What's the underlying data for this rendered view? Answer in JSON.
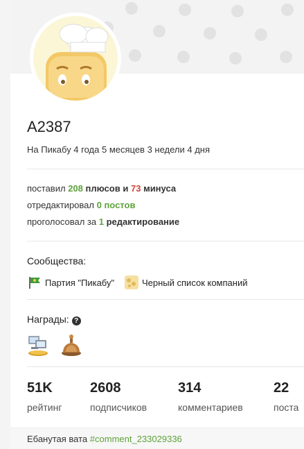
{
  "profile": {
    "username": "A2387",
    "since": "На Пикабу 4 года 5 месяцев 3 недели 4 дня"
  },
  "activity": {
    "line1": {
      "prefix": "поставил",
      "plus_count": "208",
      "plus_word": "плюсов",
      "conj": "и",
      "minus_count": "73",
      "minus_word": "минуса"
    },
    "line2": {
      "prefix": "отредактировал",
      "value": "0 постов"
    },
    "line3": {
      "prefix": "проголосовал за",
      "count": "1",
      "word": "редактирование"
    }
  },
  "communities": {
    "title": "Сообщества:",
    "items": [
      {
        "label": "Партия \"Пикабу\"",
        "icon": "flag-icon"
      },
      {
        "label": "Черный список компаний",
        "icon": "cheese-icon"
      }
    ]
  },
  "awards": {
    "title": "Награды:",
    "items": [
      {
        "icon": "computers-award-icon"
      },
      {
        "icon": "bell-award-icon"
      }
    ]
  },
  "metrics": [
    {
      "value": "51K",
      "label": "рейтинг"
    },
    {
      "value": "2608",
      "label": "подписчиков"
    },
    {
      "value": "314",
      "label": "комментариев"
    },
    {
      "value": "22",
      "label": "поста"
    }
  ],
  "comment": {
    "text": "Ебанутая вата",
    "link": "#comment_233029336"
  },
  "colors": {
    "accent_green": "#5ea23c",
    "accent_red": "#d0463a"
  }
}
